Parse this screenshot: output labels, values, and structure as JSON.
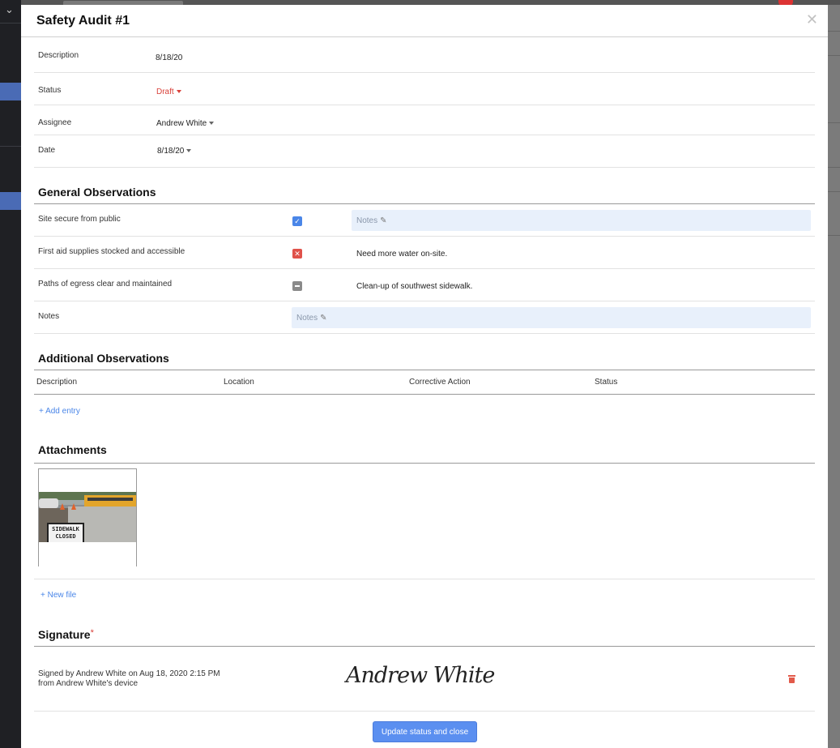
{
  "modal": {
    "title": "Safety Audit #1",
    "close_icon": "close-icon"
  },
  "fields": {
    "description": {
      "label": "Description",
      "value": "8/18/20"
    },
    "status": {
      "label": "Status",
      "value": "Draft",
      "color": "#d9413a"
    },
    "assignee": {
      "label": "Assignee",
      "value": "Andrew White"
    },
    "date": {
      "label": "Date",
      "value": "8/18/20"
    }
  },
  "general_observations": {
    "title": "General Observations",
    "items": [
      {
        "label": "Site secure from public",
        "state": "checked",
        "notes_placeholder": "Notes"
      },
      {
        "label": "First aid supplies stocked and accessible",
        "state": "failed",
        "note": "Need more water on-site."
      },
      {
        "label": "Paths of egress clear and maintained",
        "state": "na",
        "note": "Clean-up of southwest sidewalk."
      }
    ],
    "notes": {
      "label": "Notes",
      "placeholder": "Notes"
    }
  },
  "additional_observations": {
    "title": "Additional Observations",
    "columns": [
      "Description",
      "Location",
      "Corrective Action",
      "Status"
    ],
    "add_entry": "+ Add entry"
  },
  "attachments": {
    "title": "Attachments",
    "image_sign_text": "SIDEWALK CLOSED",
    "new_file": "+ New file"
  },
  "signature": {
    "title": "Signature",
    "required_mark": "*",
    "signed_line1": "Signed by Andrew White on Aug 18, 2020 2:15 PM",
    "signed_line2": "from Andrew White's device",
    "script_name": "Andrew White",
    "trash_icon": "trash-icon"
  },
  "footer": {
    "update_button": "Update status and close",
    "accent": "#5b8ff0"
  }
}
